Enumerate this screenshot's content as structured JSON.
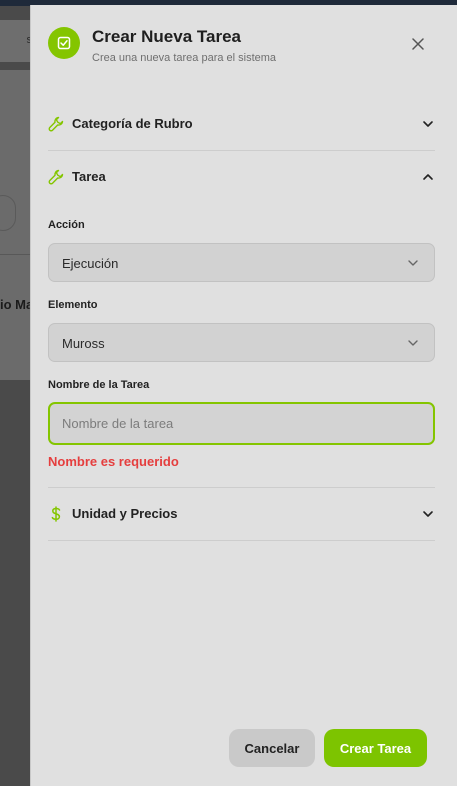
{
  "background": {
    "partial_text": "io Ma",
    "partial_glyph": "s"
  },
  "drawer": {
    "header": {
      "title": "Crear Nueva Tarea",
      "subtitle": "Crea una nueva tarea para el sistema",
      "icon": "task-checkbox-icon",
      "close_icon": "close-icon"
    },
    "sections": {
      "categoria": {
        "label": "Categoría de Rubro",
        "icon": "wrench-icon",
        "expanded": false
      },
      "tarea": {
        "label": "Tarea",
        "icon": "wrench-icon",
        "expanded": true
      },
      "unidad": {
        "label": "Unidad y Precios",
        "icon": "dollar-icon",
        "expanded": false
      }
    },
    "fields": {
      "accion": {
        "label": "Acción",
        "value": "Ejecución"
      },
      "elemento": {
        "label": "Elemento",
        "value": "Muross"
      },
      "nombre": {
        "label": "Nombre de la Tarea",
        "value": "",
        "placeholder": "Nombre de la tarea",
        "error": "Nombre es requerido"
      }
    },
    "buttons": {
      "cancel": "Cancelar",
      "create": "Crear Tarea"
    }
  },
  "colors": {
    "accent": "#84c500",
    "error": "#e53e3e",
    "drawer_bg": "#e0e0e0"
  }
}
